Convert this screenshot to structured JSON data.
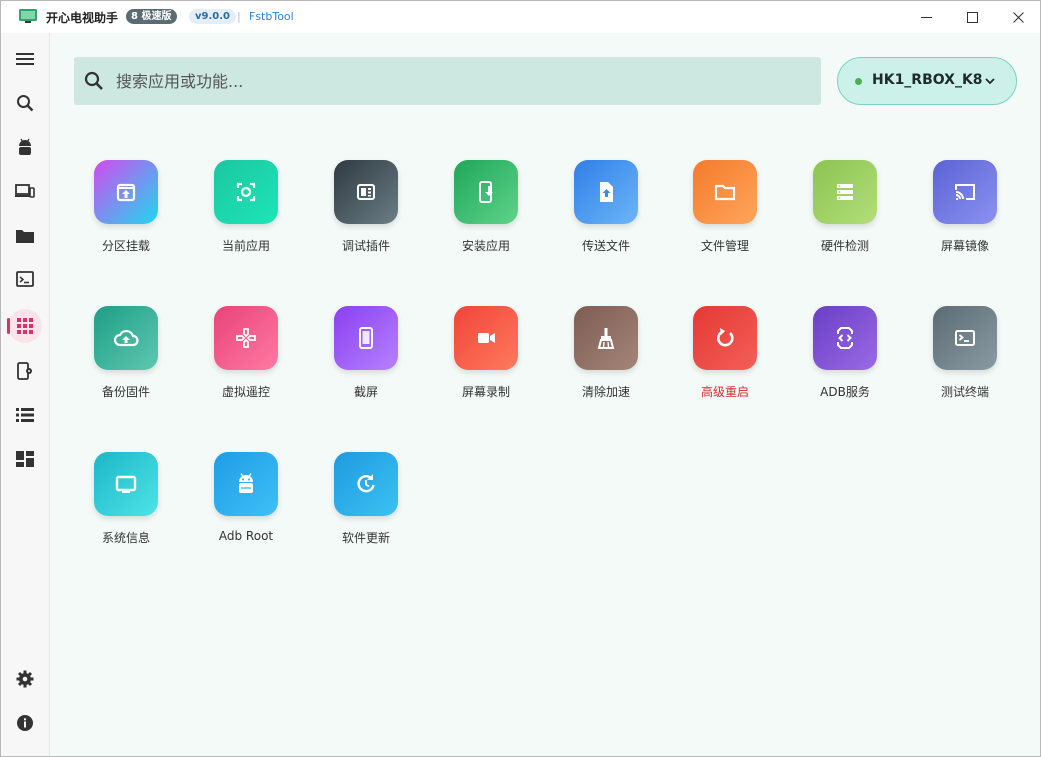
{
  "titlebar": {
    "app_title": "开心电视助手",
    "edition": "8 极速版",
    "version": "v9.0.0",
    "separator": "|",
    "tool_name": "FstbTool"
  },
  "sidebar": {
    "items": [
      {
        "icon": "menu-icon"
      },
      {
        "icon": "search-icon"
      },
      {
        "icon": "android-icon"
      },
      {
        "icon": "devices-icon"
      },
      {
        "icon": "folder-icon"
      },
      {
        "icon": "terminal-icon"
      },
      {
        "icon": "apps-grid-icon",
        "active": true
      },
      {
        "icon": "phone-settings-icon"
      },
      {
        "icon": "list-icon"
      },
      {
        "icon": "dashboard-icon"
      },
      {
        "icon": "settings-icon"
      },
      {
        "icon": "info-icon"
      }
    ],
    "accent": "#d6336c"
  },
  "search": {
    "placeholder": "搜索应用或功能..."
  },
  "device": {
    "name": "HK1_RBOX_K8",
    "status_color": "#4caf50"
  },
  "apps": [
    {
      "label": "分区挂载",
      "icon": "partition-mount-icon",
      "colors": [
        "#d24bf0",
        "#1ed8f0"
      ]
    },
    {
      "label": "当前应用",
      "icon": "current-app-icon",
      "colors": [
        "#1cc6a0",
        "#1ce6b8"
      ]
    },
    {
      "label": "调试插件",
      "icon": "debug-plugin-icon",
      "colors": [
        "#2f3a40",
        "#6b7d86"
      ]
    },
    {
      "label": "安装应用",
      "icon": "install-app-icon",
      "colors": [
        "#1fa65a",
        "#5ed48a"
      ]
    },
    {
      "label": "传送文件",
      "icon": "send-file-icon",
      "colors": [
        "#2f7fe8",
        "#6cb6f8"
      ]
    },
    {
      "label": "文件管理",
      "icon": "file-manager-icon",
      "colors": [
        "#f47a2c",
        "#ffa65a"
      ]
    },
    {
      "label": "硬件检测",
      "icon": "hardware-check-icon",
      "colors": [
        "#8cc451",
        "#b2de7a"
      ]
    },
    {
      "label": "屏幕镜像",
      "icon": "screen-mirror-icon",
      "colors": [
        "#5b63d6",
        "#8b92f0"
      ]
    },
    {
      "label": "备份固件",
      "icon": "backup-firmware-icon",
      "colors": [
        "#1f9e86",
        "#5ec8b0"
      ]
    },
    {
      "label": "虚拟遥控",
      "icon": "virtual-remote-icon",
      "colors": [
        "#e8437a",
        "#ff7aa3"
      ]
    },
    {
      "label": "截屏",
      "icon": "screenshot-icon",
      "colors": [
        "#8b3ff0",
        "#b682ff"
      ]
    },
    {
      "label": "屏幕录制",
      "icon": "screen-record-icon",
      "colors": [
        "#f0453a",
        "#ff7a5e"
      ]
    },
    {
      "label": "清除加速",
      "icon": "clean-boost-icon",
      "colors": [
        "#7d5d52",
        "#a58479"
      ]
    },
    {
      "label": "高级重启",
      "icon": "advanced-reboot-icon",
      "colors": [
        "#e53935",
        "#f25f57"
      ],
      "danger": true
    },
    {
      "label": "ADB服务",
      "icon": "adb-service-icon",
      "colors": [
        "#6a3fc4",
        "#9a6ae6"
      ]
    },
    {
      "label": "测试终端",
      "icon": "test-terminal-icon",
      "colors": [
        "#5a6b74",
        "#8a9ba4"
      ]
    },
    {
      "label": "系统信息",
      "icon": "system-info-icon",
      "colors": [
        "#1cb6c8",
        "#4ee4e6"
      ]
    },
    {
      "label": "Adb Root",
      "icon": "adb-root-icon",
      "colors": [
        "#1e9de6",
        "#3fc0f6"
      ]
    },
    {
      "label": "软件更新",
      "icon": "software-update-icon",
      "colors": [
        "#1e9ae0",
        "#3cc2f2"
      ]
    }
  ]
}
